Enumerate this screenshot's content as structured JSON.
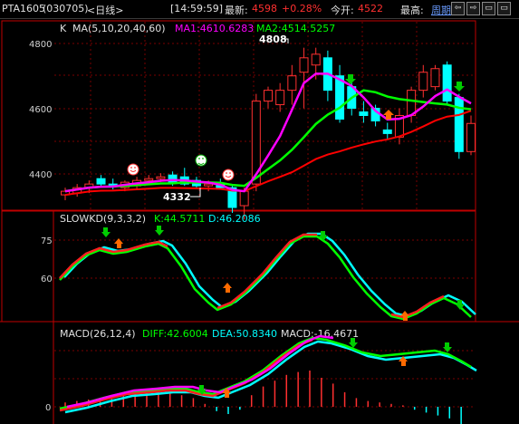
{
  "header": {
    "symbol": "PTA1605",
    "code": "(030705)",
    "period": "<日线>",
    "time": "[14:59:59]",
    "latest_label": "最新:",
    "latest_value": "4598",
    "change": "+0.28%",
    "open_label": "今开:",
    "open_value": "4522",
    "high_label": "最高:",
    "period_menu": "周期",
    "nav_buttons": [
      "⇦",
      "⇨",
      "▭",
      "▭"
    ]
  },
  "main_panel": {
    "prefix": "K",
    "ma_label": "MA(5,10,20,40,60)",
    "ma1": "MA1:4610.6283",
    "ma2": "MA2:4514.5257",
    "y_ticks": [
      "4800",
      "4600",
      "4400"
    ],
    "annotation_high": "4808",
    "annotation_low": "4332"
  },
  "kd_panel": {
    "title": "SLOWKD(9,3,3,2)",
    "k": "K:44.5711",
    "d": "D:46.2086",
    "y_ticks": [
      "75",
      "60"
    ]
  },
  "macd_panel": {
    "title": "MACD(26,12,4)",
    "diff": "DIFF:42.6004",
    "dea": "DEA:50.8340",
    "macd": "MACD:-16.4671",
    "y_ticks": [
      "0"
    ]
  },
  "colors": {
    "up": "#ff3030",
    "down": "#00ffff",
    "ma1": "#ff00ff",
    "ma2": "#00ff00",
    "ma3": "#ff0000",
    "yellow": "#ffff00",
    "grid": "#7a0000"
  },
  "chart_data": {
    "type": "candlestick",
    "y_range": [
      4360,
      4880
    ],
    "candles": [
      {
        "o": 4400,
        "h": 4420,
        "l": 4385,
        "c": 4410
      },
      {
        "o": 4405,
        "h": 4430,
        "l": 4395,
        "c": 4420
      },
      {
        "o": 4420,
        "h": 4440,
        "l": 4405,
        "c": 4430
      },
      {
        "o": 4445,
        "h": 4455,
        "l": 4425,
        "c": 4430
      },
      {
        "o": 4430,
        "h": 4445,
        "l": 4415,
        "c": 4425
      },
      {
        "o": 4420,
        "h": 4440,
        "l": 4410,
        "c": 4435
      },
      {
        "o": 4425,
        "h": 4450,
        "l": 4415,
        "c": 4440
      },
      {
        "o": 4440,
        "h": 4455,
        "l": 4430,
        "c": 4445
      },
      {
        "o": 4445,
        "h": 4460,
        "l": 4435,
        "c": 4450
      },
      {
        "o": 4455,
        "h": 4465,
        "l": 4425,
        "c": 4435
      },
      {
        "o": 4450,
        "h": 4475,
        "l": 4425,
        "c": 4430
      },
      {
        "o": 4440,
        "h": 4450,
        "l": 4420,
        "c": 4425
      },
      {
        "o": 4425,
        "h": 4440,
        "l": 4410,
        "c": 4430
      },
      {
        "o": 4430,
        "h": 4445,
        "l": 4415,
        "c": 4420
      },
      {
        "o": 4420,
        "h": 4430,
        "l": 4350,
        "c": 4365
      },
      {
        "o": 4370,
        "h": 4420,
        "l": 4332,
        "c": 4410
      },
      {
        "o": 4430,
        "h": 4680,
        "l": 4410,
        "c": 4660
      },
      {
        "o": 4660,
        "h": 4700,
        "l": 4640,
        "c": 4690
      },
      {
        "o": 4650,
        "h": 4710,
        "l": 4630,
        "c": 4690
      },
      {
        "o": 4690,
        "h": 4760,
        "l": 4650,
        "c": 4730
      },
      {
        "o": 4740,
        "h": 4808,
        "l": 4640,
        "c": 4780
      },
      {
        "o": 4760,
        "h": 4808,
        "l": 4720,
        "c": 4790
      },
      {
        "o": 4780,
        "h": 4800,
        "l": 4660,
        "c": 4690
      },
      {
        "o": 4730,
        "h": 4760,
        "l": 4600,
        "c": 4610
      },
      {
        "o": 4700,
        "h": 4730,
        "l": 4620,
        "c": 4640
      },
      {
        "o": 4630,
        "h": 4660,
        "l": 4600,
        "c": 4620
      },
      {
        "o": 4640,
        "h": 4650,
        "l": 4590,
        "c": 4605
      },
      {
        "o": 4580,
        "h": 4600,
        "l": 4555,
        "c": 4570
      },
      {
        "o": 4560,
        "h": 4640,
        "l": 4540,
        "c": 4620
      },
      {
        "o": 4620,
        "h": 4700,
        "l": 4600,
        "c": 4690
      },
      {
        "o": 4690,
        "h": 4760,
        "l": 4670,
        "c": 4740
      },
      {
        "o": 4700,
        "h": 4760,
        "l": 4690,
        "c": 4750
      },
      {
        "o": 4760,
        "h": 4770,
        "l": 4650,
        "c": 4660
      },
      {
        "o": 4670,
        "h": 4680,
        "l": 4500,
        "c": 4520
      },
      {
        "o": 4520,
        "h": 4620,
        "l": 4510,
        "c": 4598
      }
    ]
  }
}
